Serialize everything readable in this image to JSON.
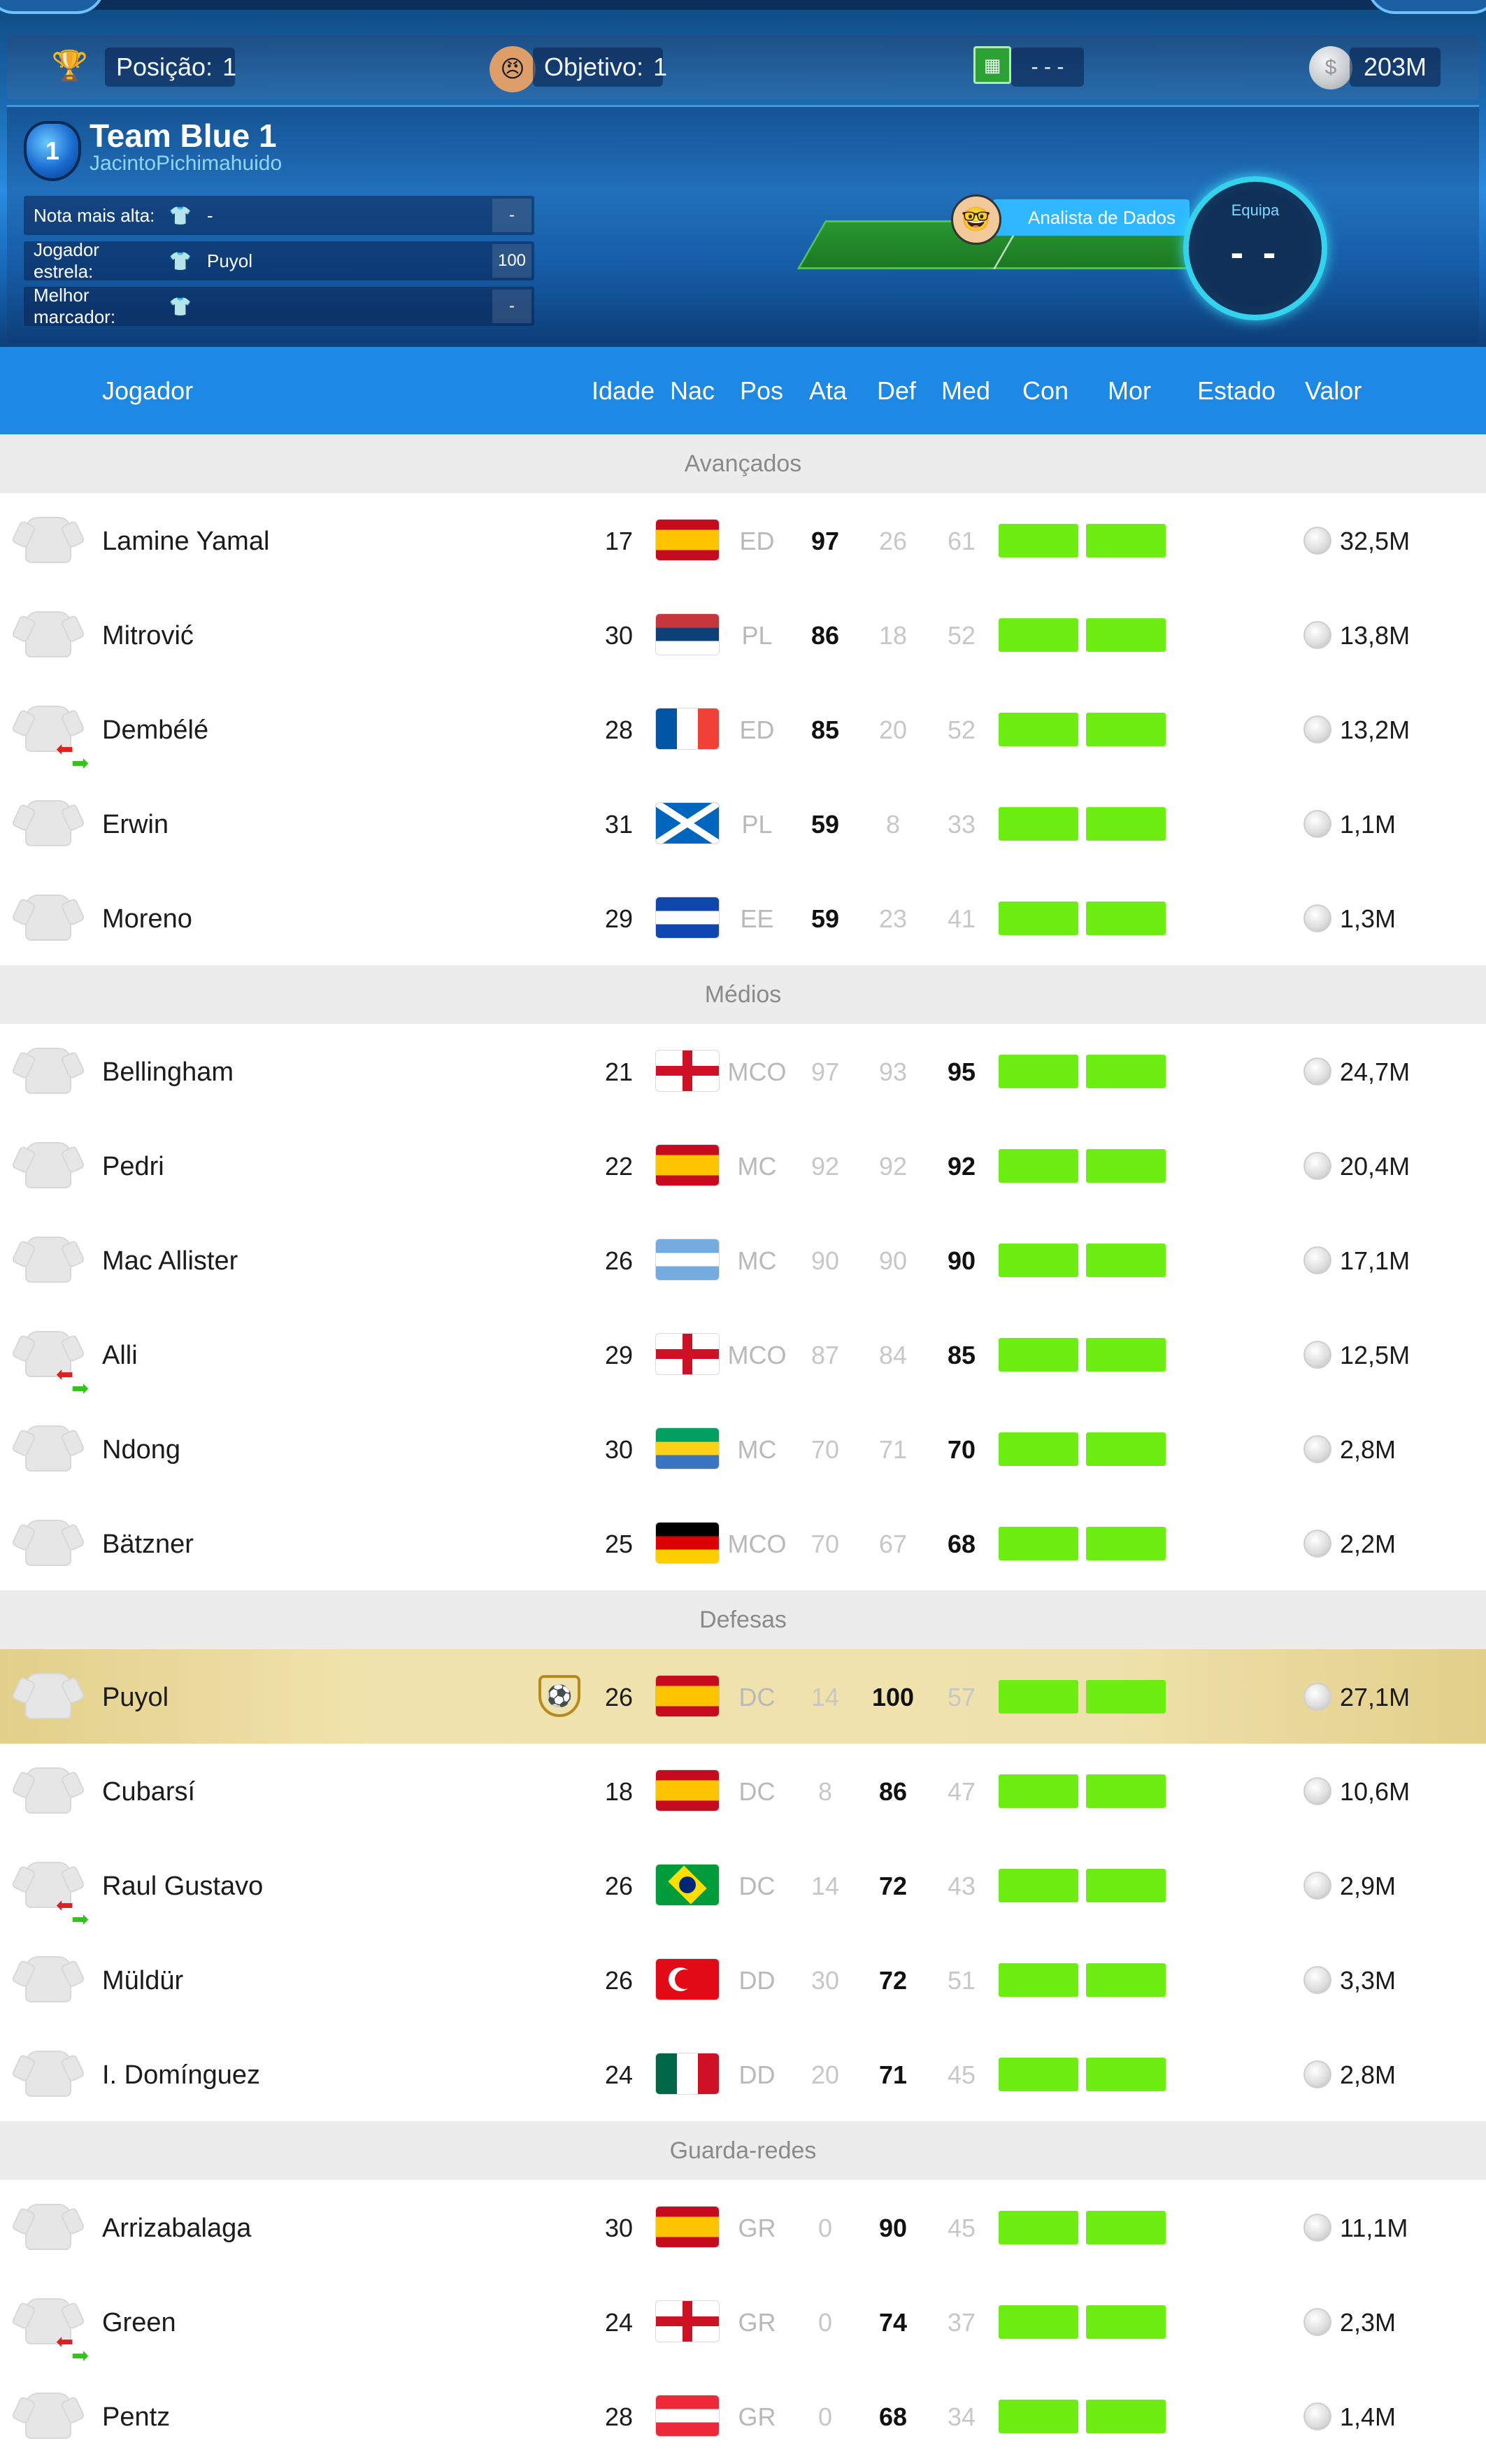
{
  "header": {
    "posicao_label": "Posição:",
    "posicao_value": "1",
    "objetivo_label": "Objetivo:",
    "objetivo_value": "1",
    "match_value": "- - -",
    "money": "203M",
    "team_badge_number": "1",
    "team_name": "Team Blue 1",
    "team_user": "JacintoPichimahuido",
    "info": [
      {
        "label": "Nota mais alta:",
        "value": "-",
        "num": "-"
      },
      {
        "label": "Jogador estrela:",
        "value": "Puyol",
        "num": "100"
      },
      {
        "label": "Melhor marcador:",
        "value": "",
        "num": "-"
      }
    ],
    "analyst_label": "Analista de Dados",
    "equipa_label": "Equipa",
    "equipa_value": "- -"
  },
  "columns": {
    "jogador": "Jogador",
    "idade": "Idade",
    "nac": "Nac",
    "pos": "Pos",
    "ata": "Ata",
    "def": "Def",
    "med": "Med",
    "con": "Con",
    "mor": "Mor",
    "estado": "Estado",
    "valor": "Valor"
  },
  "sections": [
    {
      "title": "Avançados",
      "players": [
        {
          "name": "Lamine Yamal",
          "age": "17",
          "flag": "es",
          "pos": "ED",
          "ata": "97",
          "def": "26",
          "med": "61",
          "value": "32,5M",
          "best": "ata"
        },
        {
          "name": "Mitrović",
          "age": "30",
          "flag": "rs",
          "pos": "PL",
          "ata": "86",
          "def": "18",
          "med": "52",
          "value": "13,8M",
          "best": "ata"
        },
        {
          "name": "Dembélé",
          "age": "28",
          "flag": "fr",
          "pos": "ED",
          "ata": "85",
          "def": "20",
          "med": "52",
          "value": "13,2M",
          "best": "ata",
          "transfer": true
        },
        {
          "name": "Erwin",
          "age": "31",
          "flag": "sco",
          "pos": "PL",
          "ata": "59",
          "def": "8",
          "med": "33",
          "value": "1,1M",
          "best": "ata"
        },
        {
          "name": "Moreno",
          "age": "29",
          "flag": "sv",
          "pos": "EE",
          "ata": "59",
          "def": "23",
          "med": "41",
          "value": "1,3M",
          "best": "ata"
        }
      ]
    },
    {
      "title": "Médios",
      "players": [
        {
          "name": "Bellingham",
          "age": "21",
          "flag": "en",
          "pos": "MCO",
          "ata": "97",
          "def": "93",
          "med": "95",
          "value": "24,7M",
          "best": "med"
        },
        {
          "name": "Pedri",
          "age": "22",
          "flag": "es",
          "pos": "MC",
          "ata": "92",
          "def": "92",
          "med": "92",
          "value": "20,4M",
          "best": "med"
        },
        {
          "name": "Mac Allister",
          "age": "26",
          "flag": "ar",
          "pos": "MC",
          "ata": "90",
          "def": "90",
          "med": "90",
          "value": "17,1M",
          "best": "med"
        },
        {
          "name": "Alli",
          "age": "29",
          "flag": "en",
          "pos": "MCO",
          "ata": "87",
          "def": "84",
          "med": "85",
          "value": "12,5M",
          "best": "med",
          "transfer": true
        },
        {
          "name": "Ndong",
          "age": "30",
          "flag": "ga",
          "pos": "MC",
          "ata": "70",
          "def": "71",
          "med": "70",
          "value": "2,8M",
          "best": "med"
        },
        {
          "name": "Bätzner",
          "age": "25",
          "flag": "de",
          "pos": "MCO",
          "ata": "70",
          "def": "67",
          "med": "68",
          "value": "2,2M",
          "best": "med"
        }
      ]
    },
    {
      "title": "Defesas",
      "players": [
        {
          "name": "Puyol",
          "age": "26",
          "flag": "es",
          "pos": "DC",
          "ata": "14",
          "def": "100",
          "med": "57",
          "value": "27,1M",
          "best": "def",
          "star": true
        },
        {
          "name": "Cubarsí",
          "age": "18",
          "flag": "es",
          "pos": "DC",
          "ata": "8",
          "def": "86",
          "med": "47",
          "value": "10,6M",
          "best": "def"
        },
        {
          "name": "Raul Gustavo",
          "age": "26",
          "flag": "br",
          "pos": "DC",
          "ata": "14",
          "def": "72",
          "med": "43",
          "value": "2,9M",
          "best": "def",
          "transfer": true
        },
        {
          "name": "Müldür",
          "age": "26",
          "flag": "tr",
          "pos": "DD",
          "ata": "30",
          "def": "72",
          "med": "51",
          "value": "3,3M",
          "best": "def"
        },
        {
          "name": "I. Domínguez",
          "age": "24",
          "flag": "mx",
          "pos": "DD",
          "ata": "20",
          "def": "71",
          "med": "45",
          "value": "2,8M",
          "best": "def"
        }
      ]
    },
    {
      "title": "Guarda-redes",
      "players": [
        {
          "name": "Arrizabalaga",
          "age": "30",
          "flag": "es",
          "pos": "GR",
          "ata": "0",
          "def": "90",
          "med": "45",
          "value": "11,1M",
          "best": "def"
        },
        {
          "name": "Green",
          "age": "24",
          "flag": "en",
          "pos": "GR",
          "ata": "0",
          "def": "74",
          "med": "37",
          "value": "2,3M",
          "best": "def",
          "transfer": true
        },
        {
          "name": "Pentz",
          "age": "28",
          "flag": "at",
          "pos": "GR",
          "ata": "0",
          "def": "68",
          "med": "34",
          "value": "1,4M",
          "best": "def"
        }
      ]
    }
  ],
  "colors": {
    "header_blue": "#1e88e5",
    "bar_green": "#6cee12",
    "section_grey": "#ececec",
    "star_gold": "#efe1ab"
  }
}
